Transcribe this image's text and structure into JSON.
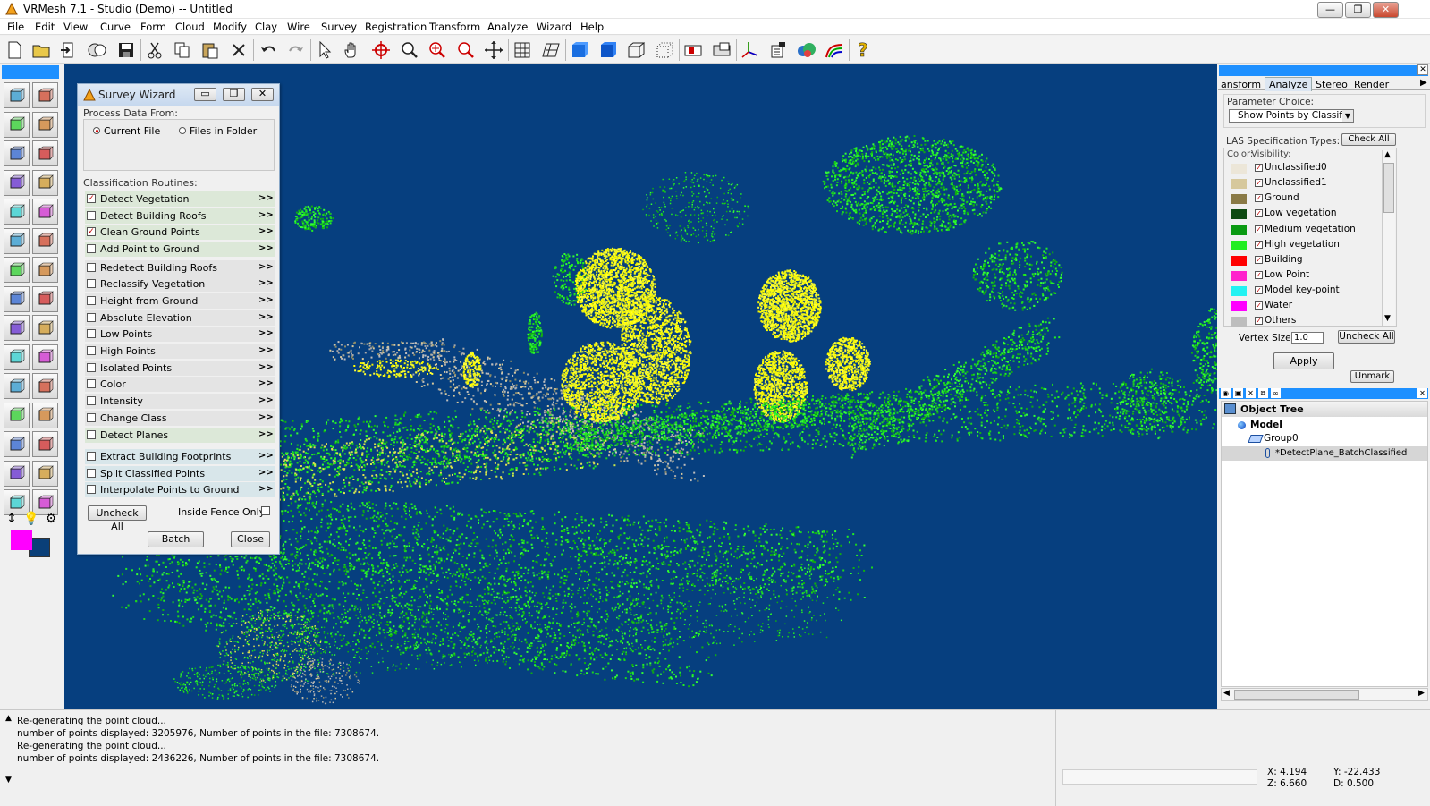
{
  "window": {
    "title": "VRMesh 7.1 - Studio (Demo) -- Untitled",
    "min_label": "—",
    "restore_label": "❐",
    "close_label": "✕"
  },
  "menu": [
    "File",
    "Edit",
    "View",
    "Curve",
    "Form",
    "Cloud",
    "Modify",
    "Clay",
    "Wire",
    "Survey",
    "Registration",
    "Transform",
    "Analyze",
    "Wizard",
    "Help"
  ],
  "toolbar_icons": [
    "new-file-icon",
    "open-folder-icon",
    "import-icon",
    "export-icon",
    "save-icon",
    "cut-icon",
    "copy-icon",
    "paste-icon",
    "delete-icon",
    "undo-icon",
    "redo-icon",
    "select-arrow-icon",
    "pan-hand-icon",
    "rotate-icon",
    "zoom-icon",
    "zoom-window-icon",
    "zoom-fit-icon",
    "zoom-all-icon",
    "grid-icon",
    "grid-plane-icon",
    "shaded-cube-icon",
    "solid-cube-icon",
    "wire-cube-icon",
    "point-cube-icon",
    "section-icon",
    "view-box-icon",
    "axis-icon",
    "properties-icon",
    "cloud-icon",
    "analysis-icon",
    "help-icon"
  ],
  "wizard": {
    "title": "Survey Wizard",
    "process_from_label": "Process Data From:",
    "source_options": [
      {
        "label": "Current File",
        "selected": true
      },
      {
        "label": "Files in Folder",
        "selected": false
      }
    ],
    "routines_label": "Classification Routines:",
    "routines": [
      {
        "label": "Detect Vegetation",
        "checked": true,
        "more": ">>"
      },
      {
        "label": "Detect Building Roofs",
        "checked": false,
        "more": ">>"
      },
      {
        "label": "Clean Ground Points",
        "checked": true,
        "more": ">>"
      },
      {
        "label": "Add Point to Ground",
        "checked": false,
        "more": ">>"
      },
      {
        "label": "Redetect Building Roofs",
        "checked": false,
        "more": ">>"
      },
      {
        "label": "Reclassify Vegetation",
        "checked": false,
        "more": ">>"
      },
      {
        "label": "Height from Ground",
        "checked": false,
        "more": ">>"
      },
      {
        "label": "Absolute Elevation",
        "checked": false,
        "more": ">>"
      },
      {
        "label": "Low Points",
        "checked": false,
        "more": ">>"
      },
      {
        "label": "High Points",
        "checked": false,
        "more": ">>"
      },
      {
        "label": "Isolated Points",
        "checked": false,
        "more": ">>"
      },
      {
        "label": "Color",
        "checked": false,
        "more": ">>"
      },
      {
        "label": "Intensity",
        "checked": false,
        "more": ">>"
      },
      {
        "label": "Change Class",
        "checked": false,
        "more": ">>"
      },
      {
        "label": "Detect Planes",
        "checked": false,
        "more": ">>"
      },
      {
        "label": "Extract Building Footprints",
        "checked": false,
        "more": ">>"
      },
      {
        "label": "Split Classified Points",
        "checked": false,
        "more": ">>"
      },
      {
        "label": "Interpolate Points to Ground",
        "checked": false,
        "more": ">>"
      }
    ],
    "uncheck_all_label": "Uncheck All",
    "inside_fence_label": "Inside Fence Only:",
    "batch_label": "Batch",
    "close_label": "Close"
  },
  "right_panel": {
    "tabs": [
      "ansform",
      "Analyze",
      "Stereo",
      "Render"
    ],
    "active_tab": "Analyze",
    "parameter_choice_label": "Parameter Choice:",
    "parameter_choice_value": "Show Points by Classific",
    "las_types_label": "LAS Specification Types:",
    "check_all_label": "Check All",
    "color_header": "Color:",
    "visibility_header": "Visibility:",
    "classes": [
      {
        "name": "Unclassified0",
        "color": "#ece6d8",
        "visible": true
      },
      {
        "name": "Unclassified1",
        "color": "#d6c89c",
        "visible": true
      },
      {
        "name": "Ground",
        "color": "#8a7a46",
        "visible": true
      },
      {
        "name": "Low vegetation",
        "color": "#0e4a12",
        "visible": true
      },
      {
        "name": "Medium vegetation",
        "color": "#0a9a12",
        "visible": true
      },
      {
        "name": "High vegetation",
        "color": "#22ee22",
        "visible": true
      },
      {
        "name": "Building",
        "color": "#ff0000",
        "visible": true
      },
      {
        "name": "Low Point",
        "color": "#ff22cc",
        "visible": true
      },
      {
        "name": "Model key-point",
        "color": "#22f2f2",
        "visible": true
      },
      {
        "name": "Water",
        "color": "#ff00ff",
        "visible": true
      },
      {
        "name": "Others",
        "color": "#bdbdbd",
        "visible": true
      }
    ],
    "vertex_size_label": "Vertex Size:",
    "vertex_size_value": "1.0",
    "uncheck_all_label": "Uncheck All",
    "apply_label": "Apply",
    "unmark_label": "Unmark",
    "object_tree": {
      "title": "Object Tree",
      "root": "Model",
      "group": "Group0",
      "item": "*DetectPlane_BatchClassified"
    }
  },
  "log": [
    "Re-generating the point cloud...",
    "number of points displayed: 3205976, Number of points in the file: 7308674.",
    "Re-generating the point cloud...",
    "number of points displayed: 2436226, Number of points in the file: 7308674."
  ],
  "coords": {
    "x": "X: 4.194",
    "y": "Y: -22.433",
    "z": "Z: 6.660",
    "d": "D: 0.500"
  },
  "colors": {
    "viewport_bg": "#063f7f",
    "palette_fg": "#ff00ff",
    "palette_bg": "#0a3f78",
    "accent_blue": "#1e90ff"
  }
}
